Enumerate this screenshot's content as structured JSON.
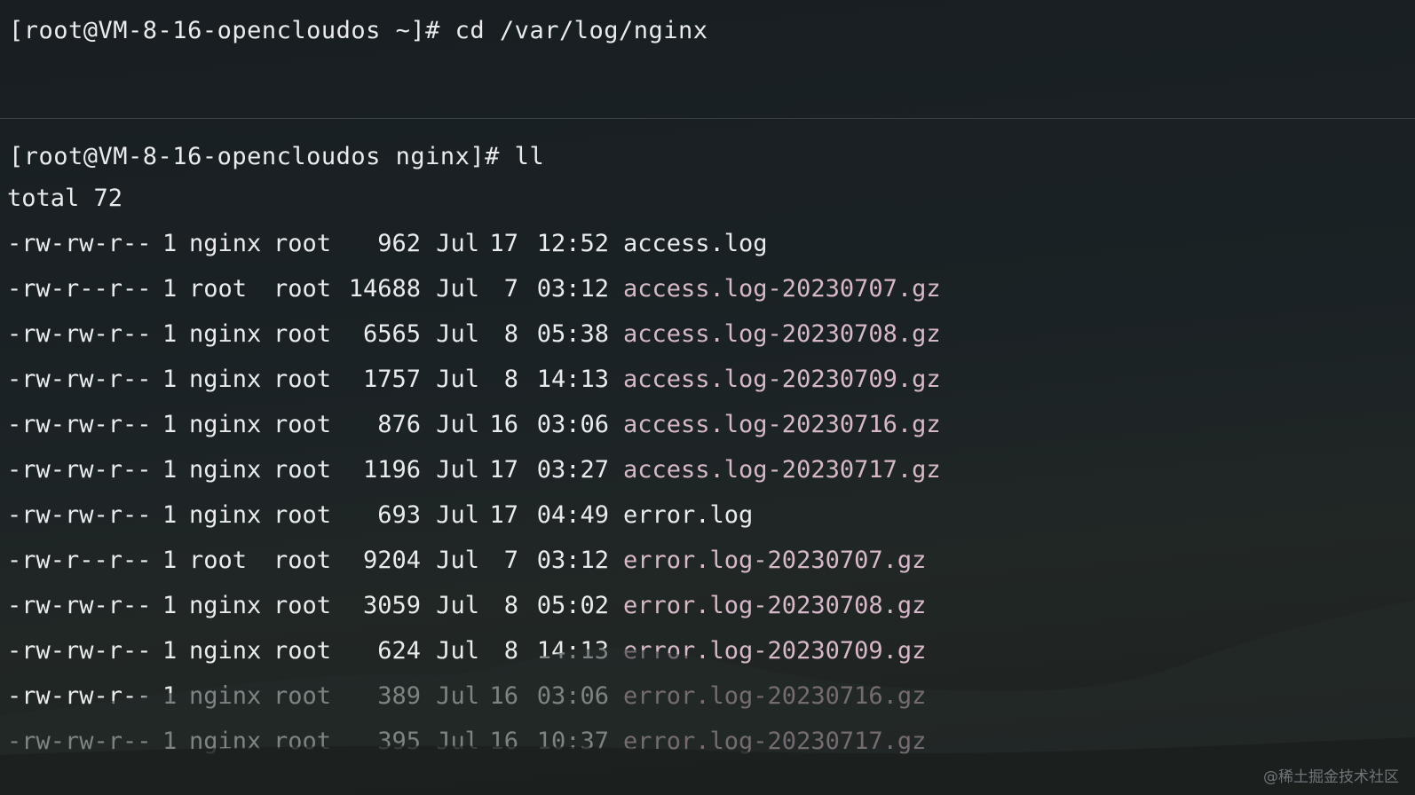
{
  "terminal": {
    "commands": {
      "cd": "[root@VM-8-16-opencloudos ~]# cd /var/log/nginx",
      "ll": "[root@VM-8-16-opencloudos nginx]# ll"
    },
    "total": "total 72",
    "files": [
      {
        "perms": "-rw-rw-r--",
        "links": "1",
        "owner": "nginx",
        "group": "root",
        "size": "962",
        "month": "Jul",
        "day": "17",
        "time": "12:52",
        "name": "access.log",
        "archive": false
      },
      {
        "perms": "-rw-r--r--",
        "links": "1",
        "owner": "root",
        "group": "root",
        "size": "14688",
        "month": "Jul",
        "day": "7",
        "time": "03:12",
        "name": "access.log-20230707.gz",
        "archive": true
      },
      {
        "perms": "-rw-rw-r--",
        "links": "1",
        "owner": "nginx",
        "group": "root",
        "size": "6565",
        "month": "Jul",
        "day": "8",
        "time": "05:38",
        "name": "access.log-20230708.gz",
        "archive": true
      },
      {
        "perms": "-rw-rw-r--",
        "links": "1",
        "owner": "nginx",
        "group": "root",
        "size": "1757",
        "month": "Jul",
        "day": "8",
        "time": "14:13",
        "name": "access.log-20230709.gz",
        "archive": true
      },
      {
        "perms": "-rw-rw-r--",
        "links": "1",
        "owner": "nginx",
        "group": "root",
        "size": "876",
        "month": "Jul",
        "day": "16",
        "time": "03:06",
        "name": "access.log-20230716.gz",
        "archive": true
      },
      {
        "perms": "-rw-rw-r--",
        "links": "1",
        "owner": "nginx",
        "group": "root",
        "size": "1196",
        "month": "Jul",
        "day": "17",
        "time": "03:27",
        "name": "access.log-20230717.gz",
        "archive": true
      },
      {
        "perms": "-rw-rw-r--",
        "links": "1",
        "owner": "nginx",
        "group": "root",
        "size": "693",
        "month": "Jul",
        "day": "17",
        "time": "04:49",
        "name": "error.log",
        "archive": false
      },
      {
        "perms": "-rw-r--r--",
        "links": "1",
        "owner": "root",
        "group": "root",
        "size": "9204",
        "month": "Jul",
        "day": "7",
        "time": "03:12",
        "name": "error.log-20230707.gz",
        "archive": true
      },
      {
        "perms": "-rw-rw-r--",
        "links": "1",
        "owner": "nginx",
        "group": "root",
        "size": "3059",
        "month": "Jul",
        "day": "8",
        "time": "05:02",
        "name": "error.log-20230708.gz",
        "archive": true
      },
      {
        "perms": "-rw-rw-r--",
        "links": "1",
        "owner": "nginx",
        "group": "root",
        "size": "624",
        "month": "Jul",
        "day": "8",
        "time": "14:13",
        "name": "error.log-20230709.gz",
        "archive": true
      },
      {
        "perms": "-rw-rw-r--",
        "links": "1",
        "owner": "nginx",
        "group": "root",
        "size": "389",
        "month": "Jul",
        "day": "16",
        "time": "03:06",
        "name": "error.log-20230716.gz",
        "archive": true
      },
      {
        "perms": "-rw-rw-r--",
        "links": "1",
        "owner": "nginx",
        "group": "root",
        "size": "395",
        "month": "Jul",
        "day": "16",
        "time": "10:37",
        "name": "error.log-20230717.gz",
        "archive": true
      }
    ]
  },
  "colors": {
    "text": "#e9ebed",
    "archive": "#d6b8c8",
    "background": "#1b2225"
  },
  "watermark": "@稀土掘金技术社区"
}
